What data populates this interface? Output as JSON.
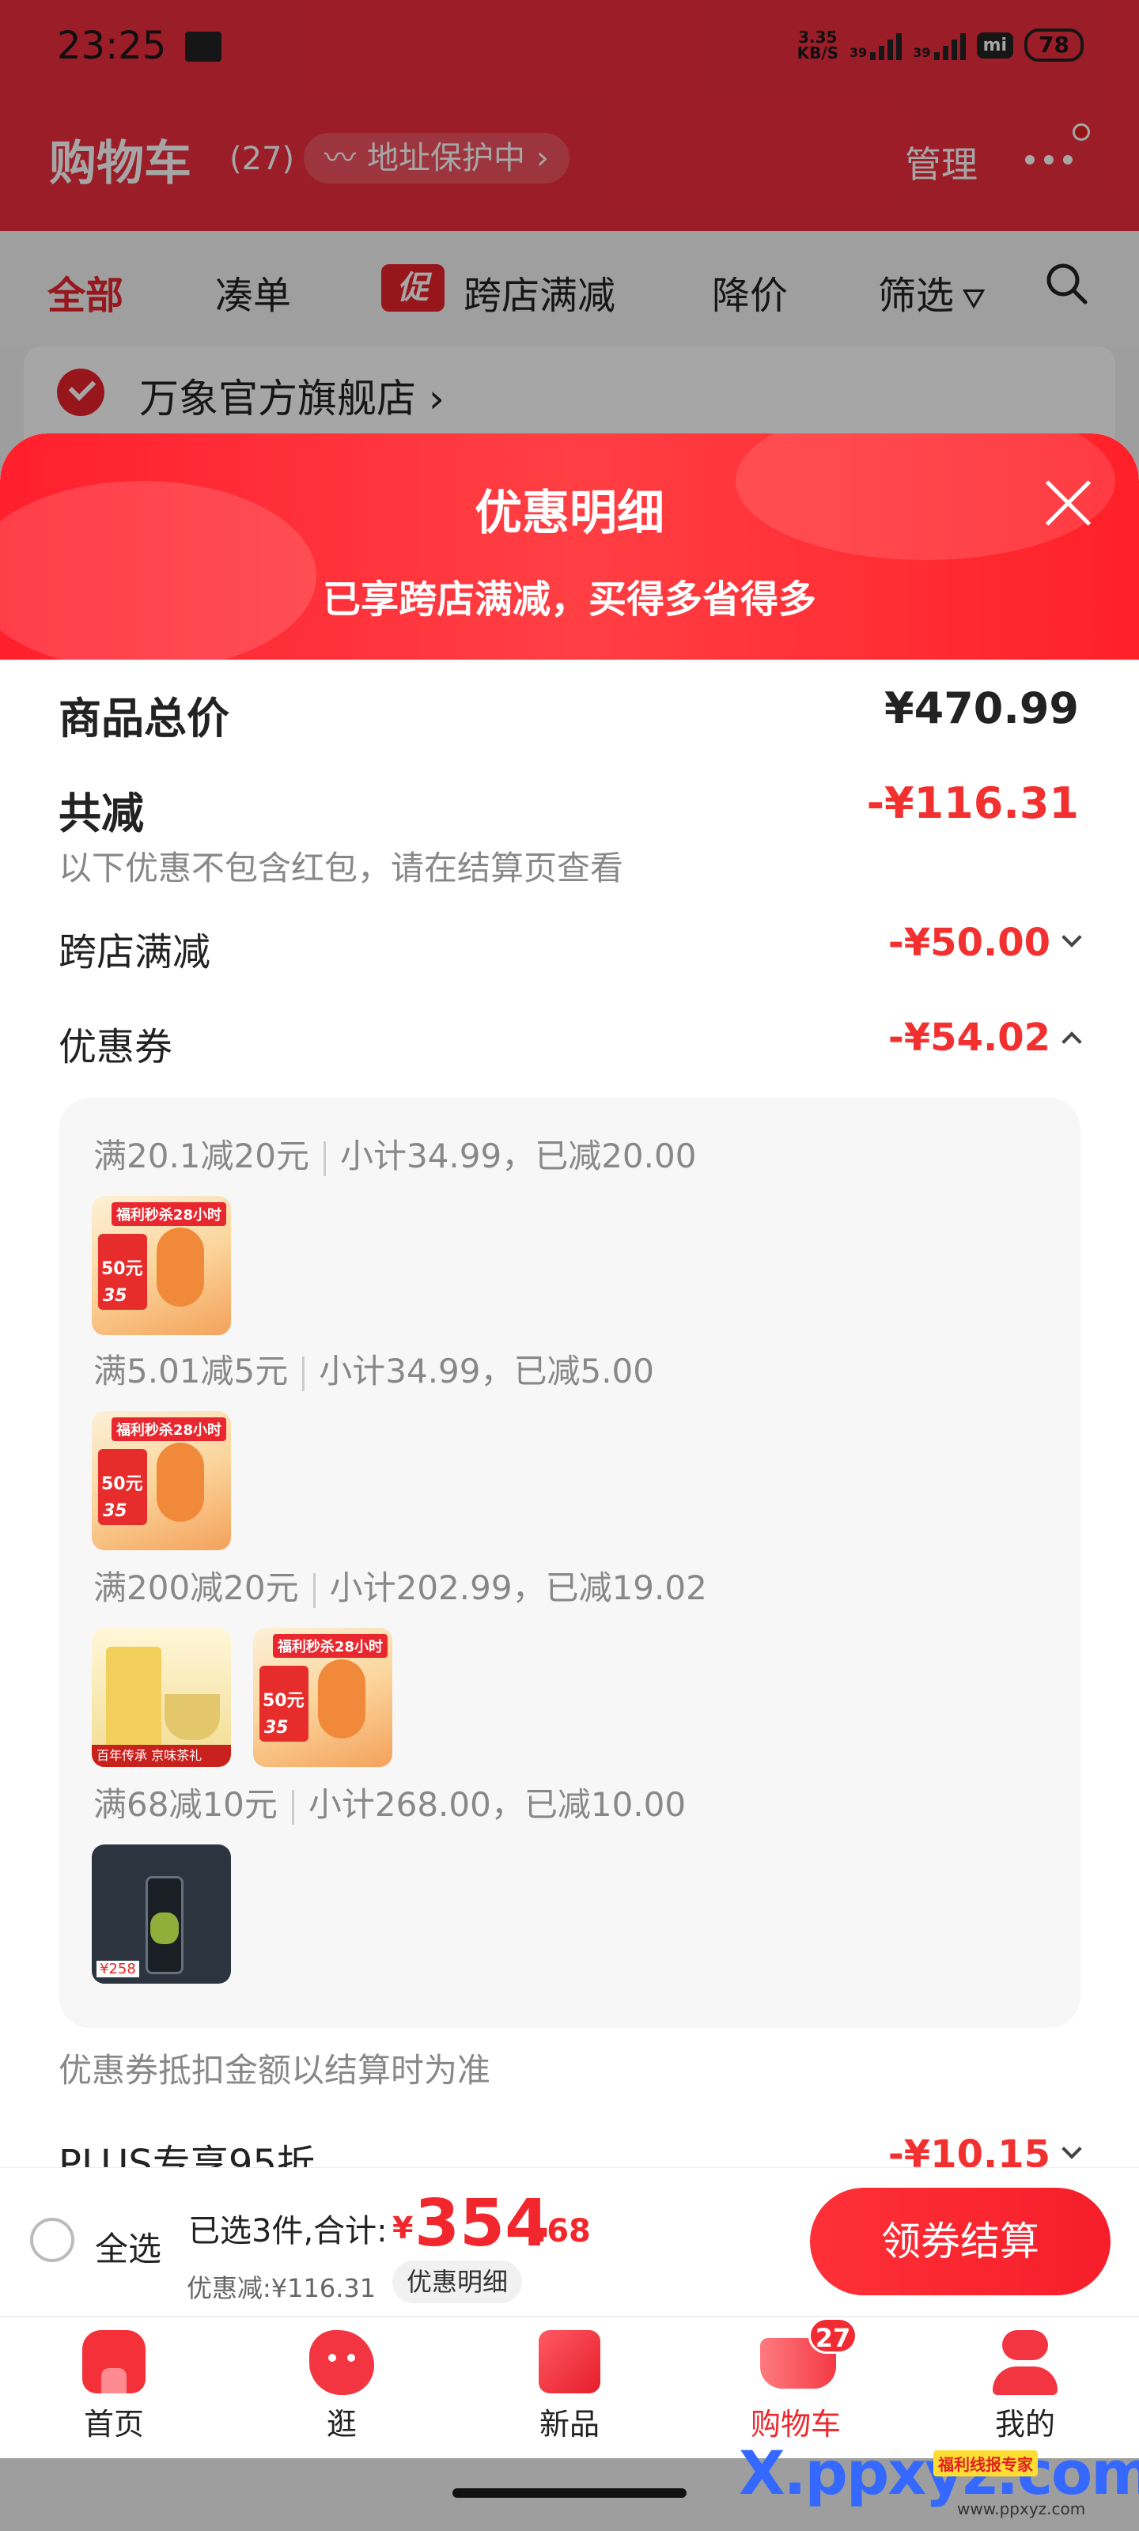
{
  "status_bar": {
    "time": "23:25",
    "speed_value": "3.35",
    "speed_unit": "KB/S",
    "signal1": "39",
    "signal2": "39",
    "mi_label": "mi",
    "battery": "78"
  },
  "header": {
    "title": "购物车",
    "count": "(27)",
    "address_protect": "地址保护中",
    "manage": "管理"
  },
  "tabs": {
    "all": "全部",
    "bundle": "凑单",
    "promo_badge": "促",
    "cross_store": "跨店满减",
    "price_drop": "降价",
    "filter": "筛选"
  },
  "shop": {
    "name": "万象官方旗舰店"
  },
  "sheet": {
    "title": "优惠明细",
    "subtitle": "已享跨店满减，买得多省得多",
    "total_label": "商品总价",
    "total_value": "¥470.99",
    "reduce_label": "共减",
    "reduce_value": "-¥116.31",
    "reduce_note": "以下优惠不包含红包，请在结算页查看",
    "cross_label": "跨店满减",
    "cross_value": "-¥50.00",
    "coupon_label": "优惠券",
    "coupon_value": "-¥54.02",
    "coupons": [
      {
        "rule": "满20.1减20元",
        "detail": "小计34.99，已减20.00"
      },
      {
        "rule": "满5.01减5元",
        "detail": "小计34.99，已减5.00"
      },
      {
        "rule": "满200减20元",
        "detail": "小计202.99，已减19.02"
      },
      {
        "rule": "满68减10元",
        "detail": "小计268.00，已减10.00"
      }
    ],
    "thumb_texts": {
      "tag": "福利秒杀28小时",
      "amount": "50元",
      "price": "35",
      "tea_label": "百年传承 京味茶礼",
      "bottle_price": "¥258"
    },
    "coupon_note": "优惠券抵扣金额以结算时为准",
    "plus_label": "PLUS专享95折",
    "plus_value": "-¥10.15"
  },
  "bottom": {
    "select_all": "全选",
    "selected_summary": "已选3件,合计:",
    "currency": "¥",
    "price_int": "354",
    "price_dec": ".68",
    "discount_summary": "优惠减:¥116.31",
    "detail_button": "优惠明细",
    "checkout": "领券结算"
  },
  "nav": {
    "home": "首页",
    "browse": "逛",
    "new": "新品",
    "cart": "购物车",
    "cart_badge": "27",
    "mine": "我的"
  },
  "watermark": {
    "logo": "X.ppxyz.com",
    "tag": "福利线报专家",
    "url": "www.ppxyz.com"
  },
  "colors": {
    "primary_red": "#f2272d",
    "sheet_header": "#ff2a33"
  }
}
